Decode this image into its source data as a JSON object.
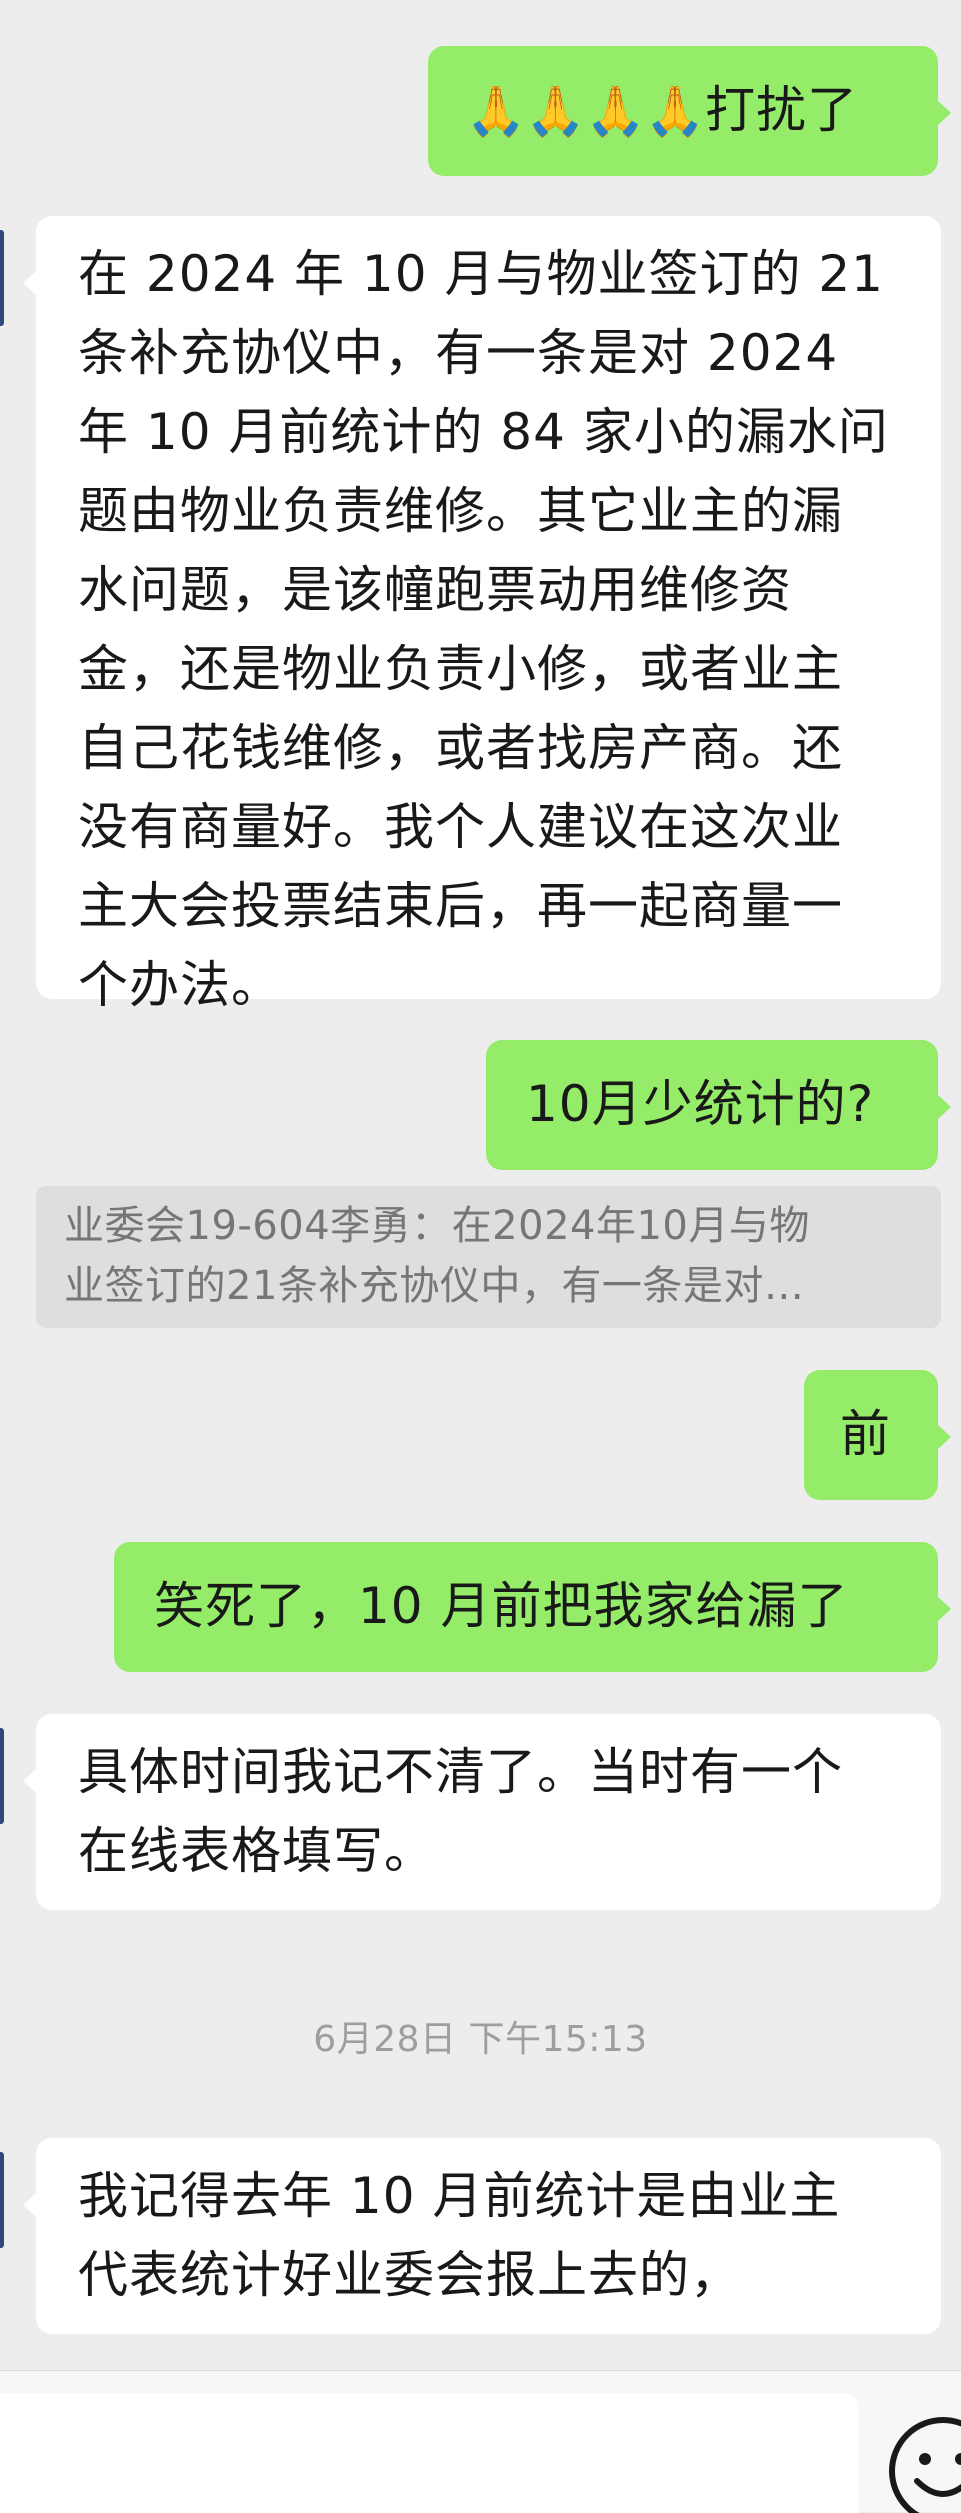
{
  "colors": {
    "chat_background": "#ededed",
    "outgoing_bubble": "#95ec69",
    "incoming_bubble": "#ffffff",
    "quote_background": "#dedede",
    "quote_text": "#767676",
    "timestamp_text": "#9e9e9e"
  },
  "messages": {
    "m1": {
      "direction": "outgoing",
      "icons": [
        "folded-hands-icon",
        "folded-hands-icon",
        "folded-hands-icon",
        "folded-hands-icon"
      ],
      "icon_glyph": "🙏",
      "text": "打扰了"
    },
    "m2": {
      "direction": "incoming",
      "lines": [
        "在 2024 年 10 月与物业签订的 21",
        "条补充协仪中，有一条是对 2024",
        "年 10 月前统计的 84 家小的漏水问",
        "题由物业负责维修。其它业主的漏",
        "水问题，是该幢跑票动用维修资",
        "金，还是物业负责小修，或者业主",
        "自己花钱维修，或者找房产商。还",
        "没有商量好。我个人建议在这次业",
        "主大会投票结束后，再一起商量一",
        "个办法。"
      ]
    },
    "m3": {
      "direction": "outgoing",
      "text": "10月少统计的?"
    },
    "quote": {
      "lines": [
        "业委会19-604李勇：在2024年10月与物",
        "业签订的21条补充协仪中，有一条是对…"
      ]
    },
    "m4": {
      "direction": "outgoing",
      "text": "前"
    },
    "m5": {
      "direction": "outgoing",
      "text": "笑死了，10 月前把我家给漏了"
    },
    "m6": {
      "direction": "incoming",
      "lines": [
        "具体时间我记不清了。当时有一个",
        "在线表格填写。"
      ]
    },
    "timestamp": "6月28日 下午15:13",
    "m7": {
      "direction": "incoming",
      "lines": [
        "我记得去年 10 月前统计是由业主",
        "代表统计好业委会报上去的，"
      ]
    }
  },
  "input_bar": {
    "value": "",
    "emoji_icon": "emoji-face-icon"
  }
}
